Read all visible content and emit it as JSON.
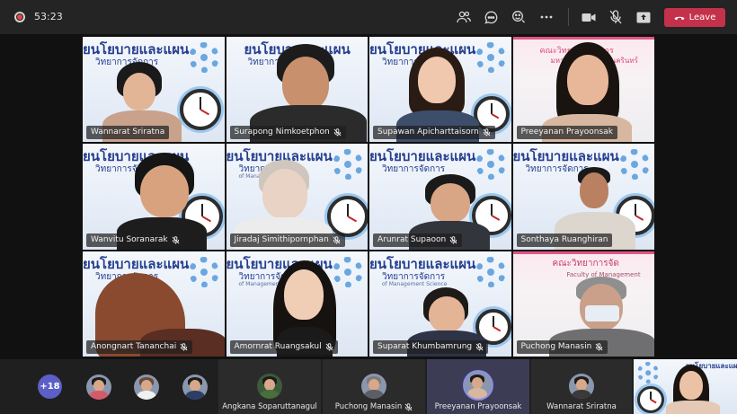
{
  "meeting": {
    "timer": "53:23",
    "leave_label": "Leave",
    "colors": {
      "leave": "#c4314b",
      "accent": "#5b5fc7",
      "background": "#1b1b1b"
    },
    "toolbar_icons": [
      "people-icon",
      "chat-icon",
      "reactions-icon",
      "more-icon",
      "camera-icon",
      "mic-off-icon",
      "share-icon"
    ]
  },
  "banner": {
    "title": "ยนโยบายและแผน",
    "subtitle": "วิทยาการจัดการ",
    "subtitle_en": "of Management Science",
    "pink_title_1": "คณะวิทยาการจัดการ",
    "pink_title_2": "มหาวิทยาลัยสงขลานครินทร์",
    "pink_title_3": "คณะวิทยาการจัด",
    "pink_sub_3": "Faculty of Management"
  },
  "tiles": [
    {
      "name": "Wannarat Sriratna",
      "muted": false
    },
    {
      "name": "Surapong Nimkoetphon",
      "muted": true
    },
    {
      "name": "Supawan Apicharttaisorn",
      "muted": true
    },
    {
      "name": "Preeyanan Prayoonsak",
      "muted": false
    },
    {
      "name": "Wanvitu Soranarak",
      "muted": true
    },
    {
      "name": "Jiradaj Simithipornphan",
      "muted": true
    },
    {
      "name": "Arunrat Supaoon",
      "muted": true
    },
    {
      "name": "Sonthaya Ruanghiran",
      "muted": false
    },
    {
      "name": "Anongnart Tananchai",
      "muted": true
    },
    {
      "name": "Amornrat Ruangsakul",
      "muted": true
    },
    {
      "name": "Suparat Khumbamrung",
      "muted": true
    },
    {
      "name": "Puchong Manasin",
      "muted": true
    }
  ],
  "strip": {
    "overflow_count": "+18",
    "named_tiles": [
      {
        "name": "Angkana Soparuttanagul",
        "muted": false
      },
      {
        "name": "Puchong Manasin",
        "muted": true
      },
      {
        "name": "Preeyanan Prayoonsak",
        "muted": false
      },
      {
        "name": "Wannarat Sriratna",
        "muted": false
      }
    ]
  }
}
